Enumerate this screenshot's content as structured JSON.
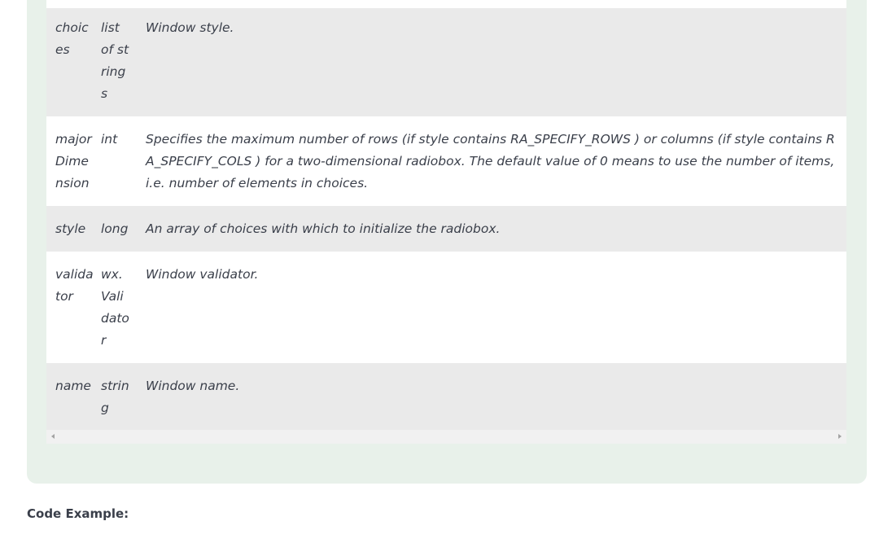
{
  "table": {
    "rows": [
      {
        "name": "choices",
        "type": "list of strings",
        "description": "Window style."
      },
      {
        "name": "majorDimension",
        "type": "int",
        "description": "Specifies the maximum number of rows (if style contains RA_SPECIFY_ROWS ) or columns (if style contains RA_SPECIFY_COLS ) for a two-dimensional radiobox. The default value of 0 means to use the number of items, i.e. number of elements in choices."
      },
      {
        "name": "style",
        "type": "long",
        "description": "An array of choices with which to initialize the radiobox."
      },
      {
        "name": "validator",
        "type": "wx.Validator",
        "description": "Window validator."
      },
      {
        "name": "name",
        "type": "string",
        "description": "Window name."
      }
    ]
  },
  "code_example": {
    "heading": "Code Example:"
  },
  "colors": {
    "panel_background": "#e8f1ea",
    "row_shaded": "#eaeaea",
    "row_plain": "#ffffff",
    "text": "#3a3f4a"
  }
}
